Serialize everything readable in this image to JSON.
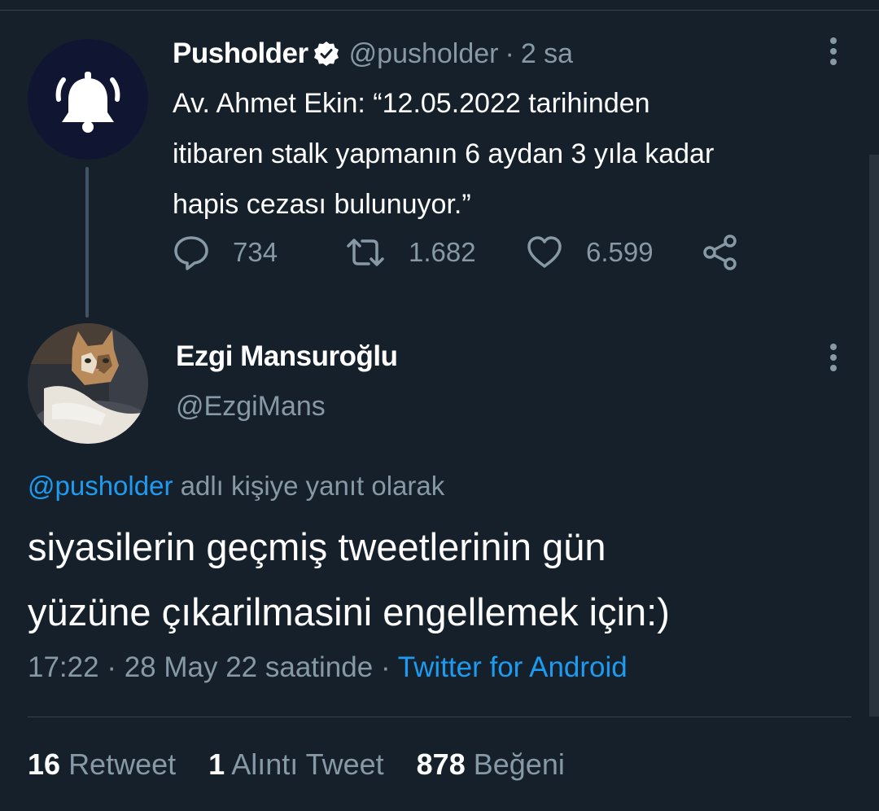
{
  "quoted_tweet": {
    "display_name": "Pusholder",
    "handle": "@pusholder",
    "separator": "·",
    "time": "2 sa",
    "avatar_icon": "bell-icon",
    "verified_icon": "verified-badge-icon",
    "text_lines": [
      "Av. Ahmet Ekin: “12.05.2022 tarihinden",
      "itibaren stalk yapmanın 6 aydan 3 yıla kadar",
      "hapis cezası bulunuyor.”"
    ],
    "actions": {
      "replies": "734",
      "retweets": "1.682",
      "likes": "6.599"
    }
  },
  "reply_tweet": {
    "display_name": "Ezgi Mansuroğlu",
    "handle": "@EzgiMans",
    "avatar_icon": "cat-avatar",
    "reply_mention": "@pusholder",
    "reply_suffix": " adlı kişiye yanıt olarak",
    "text_lines": [
      "siyasilerin geçmiş tweetlerinin gün",
      "yüzüne çıkarilmasini engellemek için:)"
    ],
    "time": "17:22",
    "date": "28 May 22 saatinde",
    "separator": "·",
    "source": "Twitter for Android",
    "stats": {
      "retweets_count": "16",
      "retweets_label": "Retweet",
      "quotes_count": "1",
      "quotes_label": "Alıntı Tweet",
      "likes_count": "878",
      "likes_label": "Beğeni"
    }
  },
  "colors": {
    "background": "#15202b",
    "accent": "#1d9bf0",
    "secondary_text": "#8899a6",
    "divider": "#38444d"
  }
}
